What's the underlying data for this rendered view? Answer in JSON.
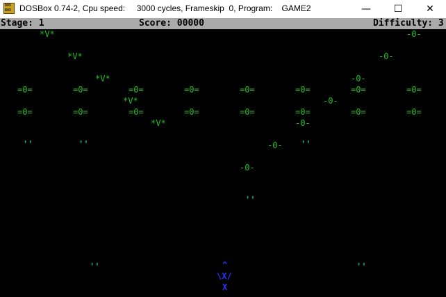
{
  "window": {
    "title": "DOSBox 0.74-2, Cpu speed:     3000 cycles, Frameskip  0, Program:    GAME2",
    "icon_text_top": "DOS",
    "icon_text_bottom": "BOX",
    "minimize_icon": "minimize-icon",
    "maximize_icon": "maximize-icon",
    "close_icon": "close-icon"
  },
  "status": {
    "stage": "Stage: 1",
    "score": "Score: 00000",
    "difficulty": "Difficulty: 3"
  },
  "sprites": {
    "alien_glyph": "*V*",
    "saucer_glyph": "-0-",
    "invader_glyph": "=0=",
    "bomb_glyph": "''",
    "player_top": "^",
    "player_mid": "\\X/",
    "player_bottom": "X"
  },
  "colors": {
    "green": "#22c222",
    "cyan": "#22a6a6",
    "blue": "#2233ff",
    "status_bar": "#aaaaaa"
  }
}
